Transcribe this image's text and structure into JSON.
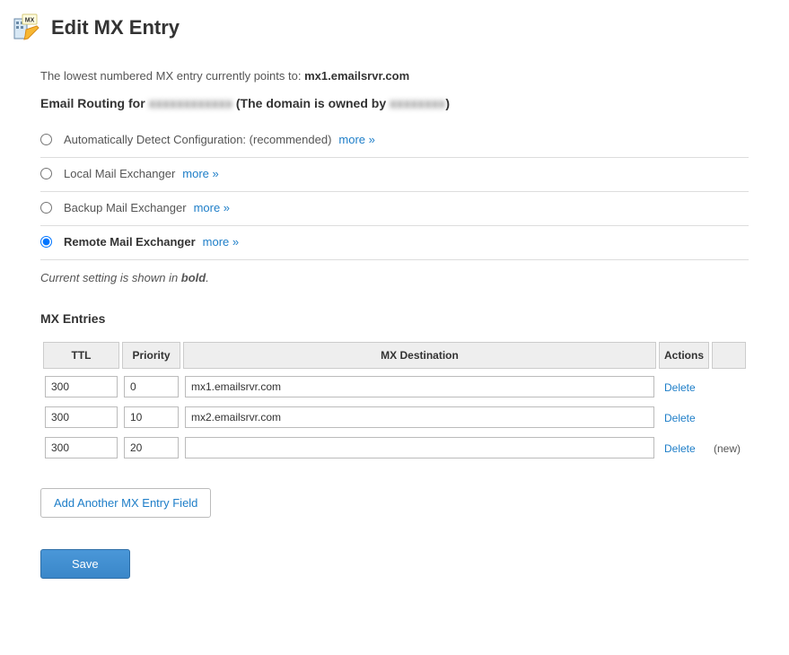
{
  "header": {
    "title": "Edit MX Entry"
  },
  "info": {
    "prefix": "The lowest numbered MX entry currently points to: ",
    "target": "mx1.emailsrvr.com"
  },
  "routing": {
    "prefix": "Email Routing for ",
    "domain_blur": "xxxxxxxxxxxx",
    "middle": " (The domain is owned by ",
    "owner_blur": "xxxxxxxx",
    "suffix": ")",
    "options": [
      {
        "label": "Automatically Detect Configuration: (recommended)",
        "more": "more »",
        "selected": false
      },
      {
        "label": "Local Mail Exchanger",
        "more": "more »",
        "selected": false
      },
      {
        "label": "Backup Mail Exchanger",
        "more": "more »",
        "selected": false
      },
      {
        "label": "Remote Mail Exchanger",
        "more": "more »",
        "selected": true
      }
    ],
    "note_prefix": "Current setting is shown in ",
    "note_bold": "bold",
    "note_suffix": "."
  },
  "mx": {
    "title": "MX Entries",
    "headers": {
      "ttl": "TTL",
      "priority": "Priority",
      "dest": "MX Destination",
      "actions": "Actions",
      "blank": ""
    },
    "rows": [
      {
        "ttl": "300",
        "priority": "0",
        "dest": "mx1.emailsrvr.com",
        "delete": "Delete",
        "tag": ""
      },
      {
        "ttl": "300",
        "priority": "10",
        "dest": "mx2.emailsrvr.com",
        "delete": "Delete",
        "tag": ""
      },
      {
        "ttl": "300",
        "priority": "20",
        "dest": "",
        "delete": "Delete",
        "tag": "(new)"
      }
    ],
    "add_label": "Add Another MX Entry Field",
    "save_label": "Save"
  }
}
